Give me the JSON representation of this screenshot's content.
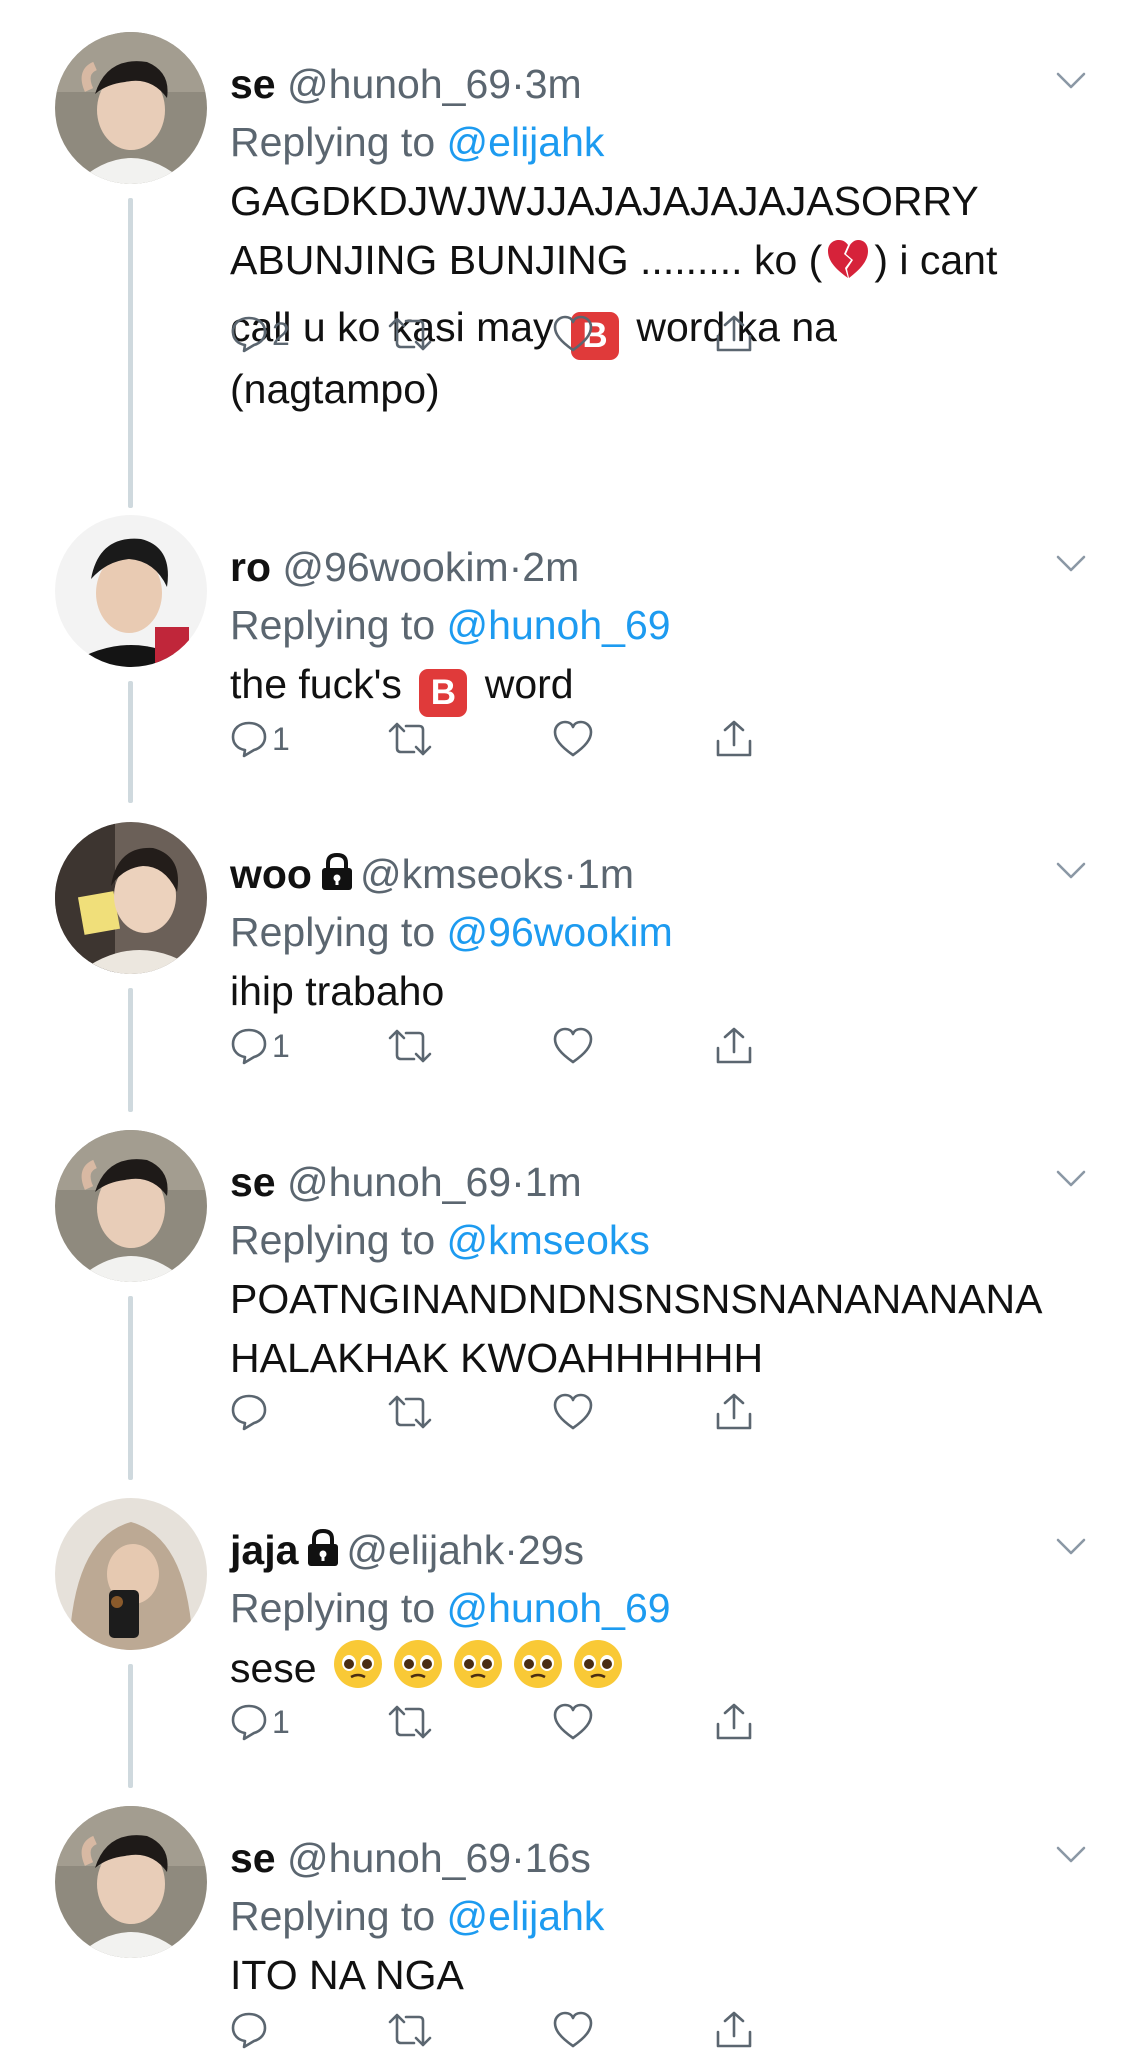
{
  "tweets": [
    {
      "name": "se",
      "handle": "@hunoh_69",
      "separator": "·",
      "time": "3m",
      "locked": false,
      "replying_prefix": "Replying to",
      "replying_handle": "@elijahk",
      "text_parts": [
        "GAGDKDJWJWJJAJAJAJAJAJASORRY\nABUNJING BUNJING ......... ko (",
        ") i cant\ncall u ko kasi may",
        "word ka na\n(nagtampo)"
      ],
      "reply_count": "2",
      "retweet_count": "",
      "like_count": "",
      "avatar": "avatar-se"
    },
    {
      "name": "ro",
      "handle": "@96wookim",
      "separator": "·",
      "time": "2m",
      "locked": false,
      "replying_prefix": "Replying to",
      "replying_handle": "@hunoh_69",
      "text_parts": [
        "the fuck's",
        "word"
      ],
      "reply_count": "1",
      "retweet_count": "",
      "like_count": "",
      "avatar": "avatar-ro"
    },
    {
      "name": "woo",
      "handle": "@kmseoks",
      "separator": "·",
      "time": "1m",
      "locked": true,
      "replying_prefix": "Replying to",
      "replying_handle": "@96wookim",
      "text_parts": [
        "ihip trabaho"
      ],
      "reply_count": "1",
      "retweet_count": "",
      "like_count": "",
      "avatar": "avatar-woo"
    },
    {
      "name": "se",
      "handle": "@hunoh_69",
      "separator": "·",
      "time": "1m",
      "locked": false,
      "replying_prefix": "Replying to",
      "replying_handle": "@kmseoks",
      "text_parts": [
        "POATNGINANDNDNSNSNSNANANANANA\nHALAKHAK KWOAHHHHHH"
      ],
      "reply_count": "",
      "retweet_count": "",
      "like_count": "",
      "avatar": "avatar-se"
    },
    {
      "name": "jaja",
      "handle": "@elijahk",
      "separator": "·",
      "time": "29s",
      "locked": true,
      "replying_prefix": "Replying to",
      "replying_handle": "@hunoh_69",
      "text_parts": [
        "sese"
      ],
      "reply_count": "1",
      "retweet_count": "",
      "like_count": "",
      "avatar": "avatar-jaja"
    },
    {
      "name": "se",
      "handle": "@hunoh_69",
      "separator": "·",
      "time": "16s",
      "locked": false,
      "replying_prefix": "Replying to",
      "replying_handle": "@elijahk",
      "text_parts": [
        "ITO NA NGA"
      ],
      "reply_count": "",
      "retweet_count": "",
      "like_count": "",
      "avatar": "avatar-se"
    }
  ],
  "inline_emoji": {
    "broken_heart": "broken-heart-emoji",
    "b_button": "B",
    "pleading_face": "pleading-face-emoji"
  },
  "colors": {
    "mention": "#1d9bf0",
    "secondary_text": "#5b6670",
    "thread_line": "#cfd9de",
    "b_button": "#e03a3a"
  }
}
